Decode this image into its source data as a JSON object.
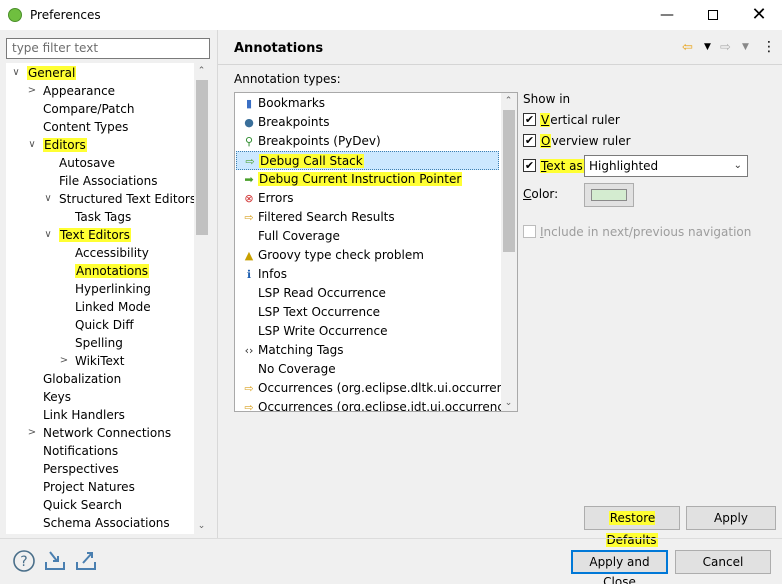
{
  "window": {
    "title": "Preferences",
    "minimize": "—",
    "close": "✕"
  },
  "filter": {
    "placeholder": "type filter text"
  },
  "tree": [
    {
      "label": "General",
      "twisty": "∨",
      "highlight": true
    },
    {
      "label": "Appearance",
      "twisty": ">"
    },
    {
      "label": "Compare/Patch"
    },
    {
      "label": "Content Types"
    },
    {
      "label": "Editors",
      "twisty": "∨",
      "highlight": true
    },
    {
      "label": "Autosave"
    },
    {
      "label": "File Associations"
    },
    {
      "label": "Structured Text Editors",
      "twisty": "∨"
    },
    {
      "label": "Task Tags"
    },
    {
      "label": "Text Editors",
      "twisty": "∨",
      "highlight": true
    },
    {
      "label": "Accessibility"
    },
    {
      "label": "Annotations",
      "highlight": true
    },
    {
      "label": "Hyperlinking"
    },
    {
      "label": "Linked Mode"
    },
    {
      "label": "Quick Diff"
    },
    {
      "label": "Spelling"
    },
    {
      "label": "WikiText",
      "twisty": ">"
    },
    {
      "label": "Globalization"
    },
    {
      "label": "Keys"
    },
    {
      "label": "Link Handlers"
    },
    {
      "label": "Network Connections",
      "twisty": ">"
    },
    {
      "label": "Notifications"
    },
    {
      "label": "Perspectives"
    },
    {
      "label": "Project Natures"
    },
    {
      "label": "Quick Search"
    },
    {
      "label": "Schema Associations"
    }
  ],
  "page": {
    "title": "Annotations"
  },
  "annotation_types": {
    "label": "Annotation types:",
    "items": [
      {
        "label": "Bookmarks",
        "icon": "bookmark-icon"
      },
      {
        "label": "Breakpoints",
        "icon": "breakpoint-dot-icon"
      },
      {
        "label": "Breakpoints (PyDev)",
        "icon": "pydev-breakpoint-icon"
      },
      {
        "label": "Debug Call Stack",
        "icon": "arrow-outline-icon",
        "highlight": true,
        "selected": true
      },
      {
        "label": "Debug Current Instruction Pointer",
        "icon": "arrow-green-icon",
        "highlight": true
      },
      {
        "label": "Errors",
        "icon": "error-icon"
      },
      {
        "label": "Filtered Search Results",
        "icon": "search-arrow-icon"
      },
      {
        "label": "Full Coverage",
        "icon": ""
      },
      {
        "label": "Groovy type check problem",
        "icon": "warning-icon"
      },
      {
        "label": "Infos",
        "icon": "info-icon"
      },
      {
        "label": "LSP Read Occurrence",
        "icon": ""
      },
      {
        "label": "LSP Text Occurrence",
        "icon": ""
      },
      {
        "label": "LSP Write Occurrence",
        "icon": ""
      },
      {
        "label": "Matching Tags",
        "icon": "tags-icon"
      },
      {
        "label": "No Coverage",
        "icon": ""
      },
      {
        "label": "Occurrences (org.eclipse.dltk.ui.occurrences)",
        "icon": "occurrence-arrow-icon"
      },
      {
        "label": "Occurrences (org.eclipse.jdt.ui.occurrences)",
        "icon": "occurrence-arrow-icon"
      }
    ]
  },
  "options": {
    "show_in": "Show in",
    "vertical_ruler_first": "V",
    "vertical_ruler_rest": "ertical ruler",
    "vertical_ruler_checked": true,
    "overview_ruler_first": "O",
    "overview_ruler_rest": "verview ruler",
    "overview_ruler_checked": true,
    "text_as_first": "T",
    "text_as_rest": "ext as",
    "text_as_checked": true,
    "text_style": "Highlighted",
    "color_first": "C",
    "color_rest": "olor:",
    "color_value": "#d4ecd0",
    "include_nav_first": "I",
    "include_nav_rest": "nclude in next/previous navigation",
    "include_nav_checked": false
  },
  "buttons": {
    "restore_defaults": "Restore Defaults",
    "apply": "Apply",
    "apply_and_close": "Apply and Close",
    "cancel": "Cancel"
  },
  "colors": {
    "highlight": "#ffff33",
    "selection": "#cce8ff",
    "accent": "#0078d7"
  }
}
